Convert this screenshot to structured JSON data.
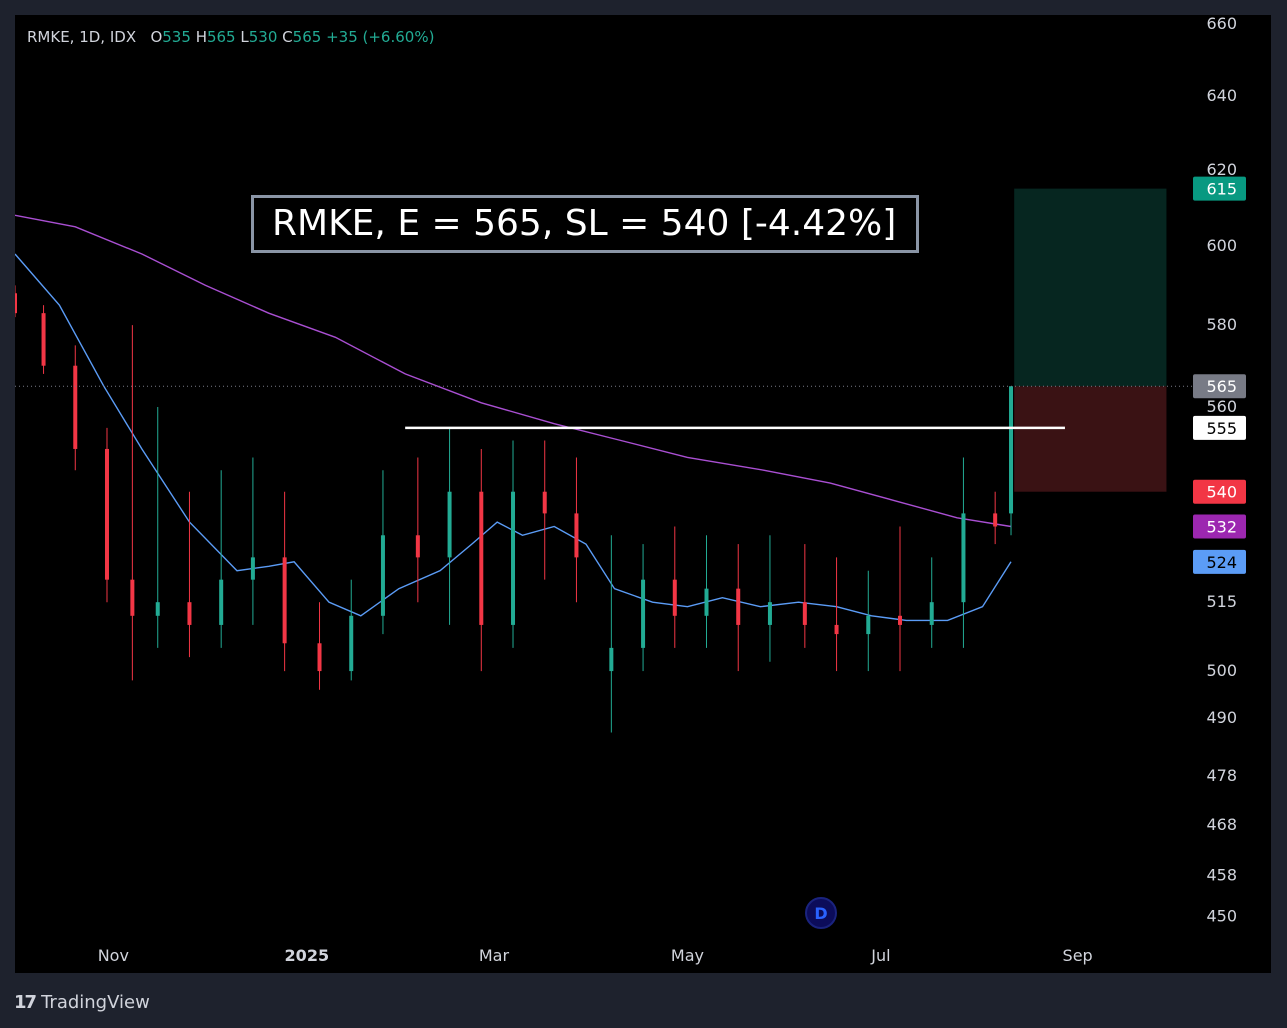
{
  "legend": {
    "symbol_info": "RMKE, 1D, IDX",
    "o_label": "O",
    "o_value": "535",
    "h_label": "H",
    "h_value": "565",
    "l_label": "L",
    "l_value": "530",
    "c_label": "C",
    "c_value": "565",
    "change": "+35 (+6.60%)"
  },
  "annotation": "RMKE, E = 565, SL = 540 [-4.42%]",
  "brand": {
    "name": "TradingView"
  },
  "event_marker": "D",
  "colors": {
    "up": "#22ab94",
    "down": "#f23645",
    "ma_fast": "#5b9cf6",
    "ma_slow": "#a94fd2",
    "target_zone": "#062620",
    "stop_zone": "#3a1214"
  },
  "chart_data": {
    "type": "candlestick",
    "symbol": "RMKE",
    "interval": "1D",
    "exchange": "IDX",
    "y_scale": "log",
    "ylim": [
      448,
      662
    ],
    "y_ticks": [
      450,
      458,
      468,
      478,
      490,
      500,
      515,
      540,
      560,
      580,
      600,
      620,
      640,
      660
    ],
    "x_range": [
      "2024-10-01",
      "2025-10-08"
    ],
    "x_ticks": [
      {
        "date": "2024-11-01",
        "label": "Nov"
      },
      {
        "date": "2025-01-01",
        "label": "2025"
      },
      {
        "date": "2025-03-01",
        "label": "Mar"
      },
      {
        "date": "2025-05-01",
        "label": "May"
      },
      {
        "date": "2025-07-01",
        "label": "Jul"
      },
      {
        "date": "2025-09-01",
        "label": "Sep"
      }
    ],
    "price_labels": [
      {
        "value": 615,
        "text": "615",
        "color": "#089981",
        "text_color": "#ffffff"
      },
      {
        "value": 565,
        "text": "565",
        "color": "#787b86",
        "text_color": "#ffffff"
      },
      {
        "value": 555,
        "text": "555",
        "color": "#ffffff",
        "text_color": "#000000"
      },
      {
        "value": 540,
        "text": "540",
        "color": "#f23645",
        "text_color": "#ffffff"
      },
      {
        "value": 532,
        "text": "532",
        "color": "#9c27b0",
        "text_color": "#ffffff"
      },
      {
        "value": 524,
        "text": "524",
        "color": "#5b9cf6",
        "text_color": "#000000"
      }
    ],
    "horizontal_line": {
      "value": 555,
      "from": "2025-02-01",
      "to": "2025-08-28"
    },
    "last_price": 565,
    "position": {
      "entry": 565,
      "stop": 540,
      "target": 615,
      "from": "2025-08-12",
      "to": "2025-09-29"
    },
    "candles": [
      {
        "date": "2024-10-01",
        "o": 588,
        "h": 590,
        "l": 582,
        "c": 583
      },
      {
        "date": "2024-10-10",
        "o": 583,
        "h": 585,
        "l": 568,
        "c": 570
      },
      {
        "date": "2024-10-20",
        "o": 570,
        "h": 575,
        "l": 545,
        "c": 550
      },
      {
        "date": "2024-10-30",
        "o": 550,
        "h": 555,
        "l": 515,
        "c": 520
      },
      {
        "date": "2024-11-07",
        "o": 520,
        "h": 580,
        "l": 498,
        "c": 512
      },
      {
        "date": "2024-11-15",
        "o": 512,
        "h": 560,
        "l": 505,
        "c": 515
      },
      {
        "date": "2024-11-25",
        "o": 515,
        "h": 540,
        "l": 503,
        "c": 510
      },
      {
        "date": "2024-12-05",
        "o": 510,
        "h": 545,
        "l": 505,
        "c": 520
      },
      {
        "date": "2024-12-15",
        "o": 520,
        "h": 548,
        "l": 510,
        "c": 525
      },
      {
        "date": "2024-12-25",
        "o": 525,
        "h": 540,
        "l": 500,
        "c": 506
      },
      {
        "date": "2025-01-05",
        "o": 506,
        "h": 515,
        "l": 496,
        "c": 500
      },
      {
        "date": "2025-01-15",
        "o": 500,
        "h": 520,
        "l": 498,
        "c": 512
      },
      {
        "date": "2025-01-25",
        "o": 512,
        "h": 545,
        "l": 508,
        "c": 530
      },
      {
        "date": "2025-02-05",
        "o": 530,
        "h": 548,
        "l": 515,
        "c": 525
      },
      {
        "date": "2025-02-15",
        "o": 525,
        "h": 555,
        "l": 510,
        "c": 540
      },
      {
        "date": "2025-02-25",
        "o": 540,
        "h": 550,
        "l": 500,
        "c": 510
      },
      {
        "date": "2025-03-07",
        "o": 510,
        "h": 552,
        "l": 505,
        "c": 540
      },
      {
        "date": "2025-03-17",
        "o": 540,
        "h": 552,
        "l": 520,
        "c": 535
      },
      {
        "date": "2025-03-27",
        "o": 535,
        "h": 548,
        "l": 515,
        "c": 525
      },
      {
        "date": "2025-04-07",
        "o": 500,
        "h": 530,
        "l": 487,
        "c": 505
      },
      {
        "date": "2025-04-17",
        "o": 505,
        "h": 528,
        "l": 500,
        "c": 520
      },
      {
        "date": "2025-04-27",
        "o": 520,
        "h": 532,
        "l": 505,
        "c": 512
      },
      {
        "date": "2025-05-07",
        "o": 512,
        "h": 530,
        "l": 505,
        "c": 518
      },
      {
        "date": "2025-05-17",
        "o": 518,
        "h": 528,
        "l": 500,
        "c": 510
      },
      {
        "date": "2025-05-27",
        "o": 510,
        "h": 530,
        "l": 502,
        "c": 515
      },
      {
        "date": "2025-06-07",
        "o": 515,
        "h": 528,
        "l": 505,
        "c": 510
      },
      {
        "date": "2025-06-17",
        "o": 510,
        "h": 525,
        "l": 500,
        "c": 508
      },
      {
        "date": "2025-06-27",
        "o": 508,
        "h": 522,
        "l": 500,
        "c": 512
      },
      {
        "date": "2025-07-07",
        "o": 512,
        "h": 532,
        "l": 500,
        "c": 510
      },
      {
        "date": "2025-07-17",
        "o": 510,
        "h": 525,
        "l": 505,
        "c": 515
      },
      {
        "date": "2025-07-27",
        "o": 515,
        "h": 548,
        "l": 505,
        "c": 535
      },
      {
        "date": "2025-08-06",
        "o": 535,
        "h": 540,
        "l": 528,
        "c": 532
      },
      {
        "date": "2025-08-11",
        "o": 535,
        "h": 565,
        "l": 530,
        "c": 565
      }
    ],
    "series": [
      {
        "name": "",
        "color": "#5b9cf6",
        "points": [
          {
            "date": "2024-10-01",
            "value": 598
          },
          {
            "date": "2024-10-15",
            "value": 585
          },
          {
            "date": "2024-10-29",
            "value": 565
          },
          {
            "date": "2024-11-10",
            "value": 550
          },
          {
            "date": "2024-11-25",
            "value": 533
          },
          {
            "date": "2024-12-10",
            "value": 522
          },
          {
            "date": "2024-12-20",
            "value": 523
          },
          {
            "date": "2024-12-28",
            "value": 524
          },
          {
            "date": "2025-01-08",
            "value": 515
          },
          {
            "date": "2025-01-18",
            "value": 512
          },
          {
            "date": "2025-01-30",
            "value": 518
          },
          {
            "date": "2025-02-12",
            "value": 522
          },
          {
            "date": "2025-02-22",
            "value": 528
          },
          {
            "date": "2025-03-02",
            "value": 533
          },
          {
            "date": "2025-03-10",
            "value": 530
          },
          {
            "date": "2025-03-20",
            "value": 532
          },
          {
            "date": "2025-03-30",
            "value": 528
          },
          {
            "date": "2025-04-08",
            "value": 518
          },
          {
            "date": "2025-04-20",
            "value": 515
          },
          {
            "date": "2025-05-01",
            "value": 514
          },
          {
            "date": "2025-05-12",
            "value": 516
          },
          {
            "date": "2025-05-24",
            "value": 514
          },
          {
            "date": "2025-06-05",
            "value": 515
          },
          {
            "date": "2025-06-17",
            "value": 514
          },
          {
            "date": "2025-06-28",
            "value": 512
          },
          {
            "date": "2025-07-09",
            "value": 511
          },
          {
            "date": "2025-07-22",
            "value": 511
          },
          {
            "date": "2025-08-02",
            "value": 514
          },
          {
            "date": "2025-08-11",
            "value": 524
          }
        ]
      },
      {
        "name": "",
        "color": "#a94fd2",
        "points": [
          {
            "date": "2024-10-01",
            "value": 608
          },
          {
            "date": "2024-10-20",
            "value": 605
          },
          {
            "date": "2024-11-10",
            "value": 598
          },
          {
            "date": "2024-11-30",
            "value": 590
          },
          {
            "date": "2024-12-20",
            "value": 583
          },
          {
            "date": "2025-01-10",
            "value": 577
          },
          {
            "date": "2025-02-01",
            "value": 568
          },
          {
            "date": "2025-02-25",
            "value": 561
          },
          {
            "date": "2025-03-20",
            "value": 556
          },
          {
            "date": "2025-04-10",
            "value": 552
          },
          {
            "date": "2025-05-01",
            "value": 548
          },
          {
            "date": "2025-05-25",
            "value": 545
          },
          {
            "date": "2025-06-15",
            "value": 542
          },
          {
            "date": "2025-07-05",
            "value": 538
          },
          {
            "date": "2025-07-25",
            "value": 534
          },
          {
            "date": "2025-08-11",
            "value": 532
          }
        ]
      }
    ]
  }
}
